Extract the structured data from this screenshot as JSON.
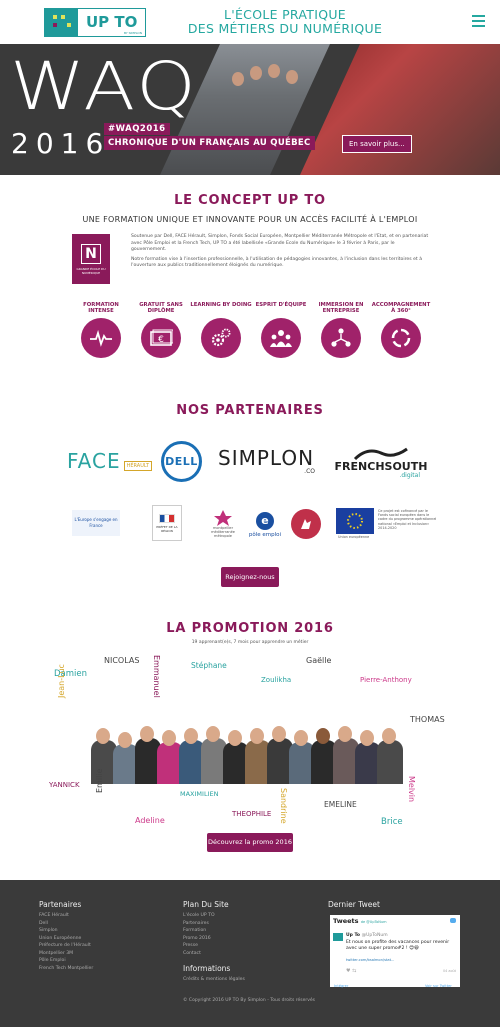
{
  "header": {
    "logo_text": "UP TO",
    "logo_sub": "BY SIMPLON",
    "tagline_line1": "L'ÉCOLE PRATIQUE",
    "tagline_line2": "DES MÉTIERS DU NUMÉRIQUE",
    "menu_icon": "hamburger-menu-icon"
  },
  "hero": {
    "title": "WAQ",
    "year": "2016",
    "hashtag": "#WAQ2016",
    "subtitle": "CHRONIQUE D'UN FRANÇAIS AU QUÉBEC",
    "button": "En savoir plus..."
  },
  "concept": {
    "heading": "LE CONCEPT UP TO",
    "subheading": "UNE FORMATION UNIQUE ET INNOVANTE POUR UN ACCÈS FACILITÉ À L'EMPLOI",
    "badge_letter": "N",
    "badge_caption": "GRANDE ÉCOLE DU NUMÉRIQUE",
    "paragraph1": "Soutenue par Dell, FACE Hérault, Simplon, Fonds Social Européen, Montpellier Méditerranée Métropole et l'Etat, et en partenariat avec Pôle Emploi et la French Tech, UP TO a été labellisée «Grande Ecole du Numérique» le 3 février à Paris, par le gouvernement.",
    "paragraph2": "Notre formation vise à l'insertion professionnelle, à l'utilisation de pédagogies innovantes, à l'inclusion dans les territoires et à l'ouverture aux publics traditionnellement éloignés du numérique.",
    "features": [
      {
        "label": "FORMATION INTENSE",
        "icon": "heartbeat-icon"
      },
      {
        "label": "GRATUIT SANS DIPLÔME",
        "icon": "euro-bill-icon"
      },
      {
        "label": "LEARNING BY DOING",
        "icon": "gears-icon"
      },
      {
        "label": "ESPRIT D'ÉQUIPE",
        "icon": "team-icon"
      },
      {
        "label": "IMMERSION EN ENTREPRISE",
        "icon": "network-icon"
      },
      {
        "label": "ACCOMPAGNEMENT À 360°",
        "icon": "circle-arrows-icon"
      }
    ]
  },
  "partners": {
    "heading": "NOS PARTENAIRES",
    "face": "FACE",
    "face_sub": "HÉRAULT",
    "dell": "DELL",
    "simplon": "SIMPLON",
    "simplon_sub": ".CO",
    "frenchsouth": "FRENCHSOUTH",
    "frenchsouth_sub": ".digital",
    "europe_engage": "L'Europe s'engage en France",
    "prefecture": "PRÉFET DE LA RÉGION",
    "montpellier": "montpellier méditerranée métropole",
    "pole_emploi": "pôle emploi",
    "eu_caption": "Union européenne",
    "eu_text": "Ce projet est cofinancé par le Fonds social européen dans le cadre du programme opérationnel national «Emploi et Inclusion» 2014-2020",
    "join_button": "Rejoignez-nous"
  },
  "promotion": {
    "heading": "LA PROMOTION 2016",
    "subtitle": "19 apprenant(e)s, 7 mois pour apprendre un métier",
    "names": [
      {
        "text": "NICOLAS",
        "color": "#444444"
      },
      {
        "text": "Damien",
        "color": "#2aa3a0"
      },
      {
        "text": "Emmanuel",
        "color": "#8a1a5a"
      },
      {
        "text": "Stéphane",
        "color": "#2aa3a0"
      },
      {
        "text": "Gaëlle",
        "color": "#444444"
      },
      {
        "text": "Zoulikha",
        "color": "#2aa3a0"
      },
      {
        "text": "Pierre-Anthony",
        "color": "#cc3a8a"
      },
      {
        "text": "Jean-Luc",
        "color": "#d4a62a"
      },
      {
        "text": "THOMAS",
        "color": "#444444"
      },
      {
        "text": "YANNICK",
        "color": "#8a1a5a"
      },
      {
        "text": "Emilie",
        "color": "#444444"
      },
      {
        "text": "MAXIMILIEN",
        "color": "#2aa3a0"
      },
      {
        "text": "Adeline",
        "color": "#cc3a8a"
      },
      {
        "text": "THEOPHILE",
        "color": "#8a1a5a"
      },
      {
        "text": "Sandrine",
        "color": "#d4a62a"
      },
      {
        "text": "EMELINE",
        "color": "#444444"
      },
      {
        "text": "Brice",
        "color": "#2aa3a0"
      },
      {
        "text": "Melvin",
        "color": "#cc3a8a"
      }
    ],
    "button": "Découvrez la promo 2016"
  },
  "footer": {
    "partners_heading": "Partenaires",
    "partners": [
      "FACE Hérault",
      "Dell",
      "Simplon",
      "Union Européenne",
      "Préfecture de l'Hérault",
      "Montpellier 3M",
      "Pôle Emploi",
      "French Tech Montpellier"
    ],
    "plan_heading": "Plan Du Site",
    "plan": [
      "L'école UP TO",
      "Partenaires",
      "Formation",
      "Promo 2016",
      "Presse",
      "Contact"
    ],
    "info_heading": "Informations",
    "info": [
      "Crédits & mentions légales"
    ],
    "tweet_heading": "Dernier Tweet",
    "tweets_label": "Tweets",
    "tweets_by": "de @UpToNum",
    "tweet_author": "Up To",
    "tweet_handle": "@UpToNum",
    "tweet_text": "Et nous on profite des vacances pour revenir avec une super promo#2 ! 😍😁",
    "tweet_link": "twitter.com/bsalmon/stat...",
    "tweet_date": "04 août",
    "embed_label": "Intégrer",
    "view_label": "Voir sur Twitter",
    "copyright": "© Copyright 2016 UP TO By Simplon - Tous droits réservés"
  },
  "colors": {
    "brand_teal": "#25a8a0",
    "brand_purple": "#8a1a5a",
    "footer_bg": "#3a3a3a"
  }
}
